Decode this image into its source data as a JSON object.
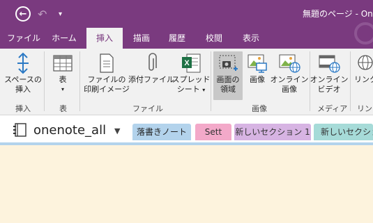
{
  "titlebar": {
    "title": "無題のページ - On"
  },
  "menu": [
    {
      "label": "ファイル"
    },
    {
      "label": "ホーム"
    },
    {
      "label": "挿入"
    },
    {
      "label": "描画"
    },
    {
      "label": "履歴"
    },
    {
      "label": "校閲"
    },
    {
      "label": "表示"
    }
  ],
  "ribbon": {
    "space_insert": {
      "line1": "スペースの",
      "line2": "挿入"
    },
    "table": {
      "line1": "表"
    },
    "file_print": {
      "line1": "ファイルの",
      "line2": "印刷イメージ"
    },
    "attach": {
      "line1": "添付ファイル"
    },
    "spreadsheet": {
      "line1": "スプレッド",
      "line2": "シート"
    },
    "screen_clip": {
      "line1": "画面の",
      "line2": "領域"
    },
    "picture": {
      "line1": "画像"
    },
    "online_picture": {
      "line1": "オンライン",
      "line2": "画像"
    },
    "online_video": {
      "line1": "オンライン",
      "line2": "ビデオ"
    },
    "link": {
      "line1": "リンク"
    },
    "groups": {
      "insert": "挿入",
      "table": "表",
      "file": "ファイル",
      "image": "画像",
      "media": "メディア",
      "link": "リンク"
    }
  },
  "notebook": {
    "name": "onenote_all"
  },
  "sections": [
    {
      "label": "落書きノート",
      "color": "#b3d3ec"
    },
    {
      "label": "Sett",
      "color": "#f3a9c9"
    },
    {
      "label": "新しいセクション 1",
      "color": "#d7b4e3"
    },
    {
      "label": "新しいセクション",
      "color": "#a6dbd8"
    }
  ],
  "colors": {
    "accent": "#7a3a7f",
    "ribbon_bg": "#f1f1f1",
    "page_bg": "#fdf3dd"
  }
}
